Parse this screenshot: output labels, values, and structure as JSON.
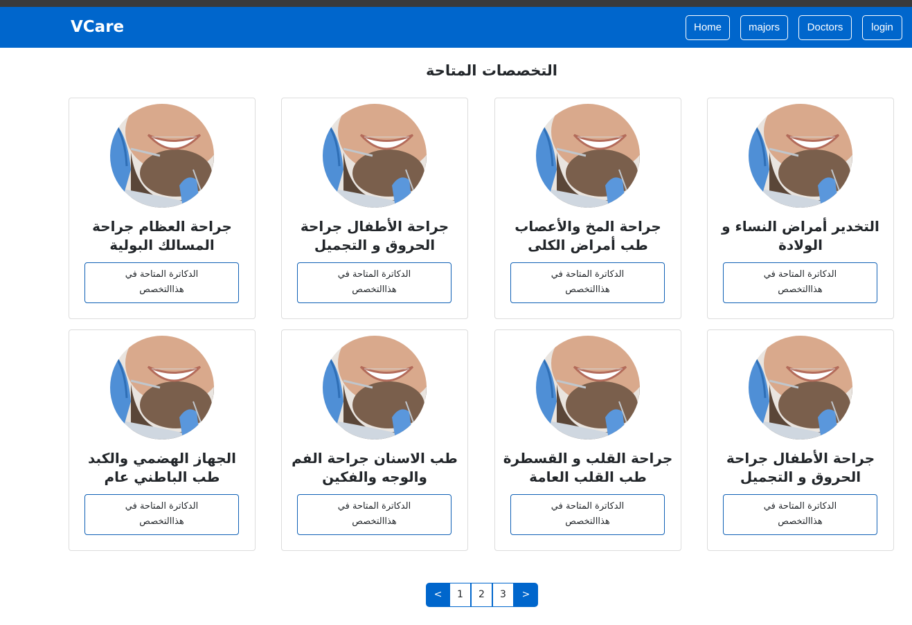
{
  "navbar": {
    "brand": "VCare",
    "links": [
      "Home",
      "majors",
      "Doctors",
      "login"
    ]
  },
  "page_title": "التخصصات المتاحة",
  "cards": [
    {
      "title_line1": "التخدير أمراض النساء و",
      "title_line2": "الولادة"
    },
    {
      "title_line1": "جراحة المخ والأعصاب",
      "title_line2": "طب أمراض الكلى"
    },
    {
      "title_line1": "جراحة الأطفال جراحة",
      "title_line2": "الحروق و التجميل"
    },
    {
      "title_line1": "جراحة العظام جراحة",
      "title_line2": "المسالك البولية"
    },
    {
      "title_line1": "جراحة الأطفال جراحة",
      "title_line2": "الحروق و التجميل"
    },
    {
      "title_line1": "جراحة القلب و القسطرة",
      "title_line2": "طب القلب العامة"
    },
    {
      "title_line1": "طب الاسنان جراحة الفم",
      "title_line2": "والوجه والفكين"
    },
    {
      "title_line1": "الجهاز الهضمي والكبد",
      "title_line2": "طب الباطني عام"
    }
  ],
  "card_button": {
    "line1": "الدكاترة المتاحة في",
    "line2": "هذاالتخصص"
  },
  "pagination": {
    "prev": "<",
    "pages": [
      "1",
      "2",
      "3"
    ],
    "next": ">"
  },
  "colors": {
    "primary": "#0066cc",
    "topbar": "#3a3a3a"
  },
  "icons": {
    "avatar": "dental-patient-photo"
  }
}
